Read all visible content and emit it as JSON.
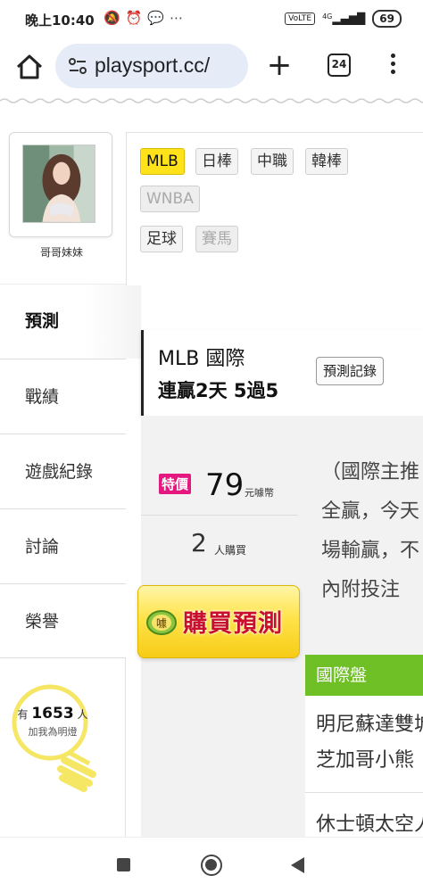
{
  "status_bar": {
    "time": "晚上10:40",
    "icons": [
      "mute-icon",
      "alarm-icon",
      "chat-bubble-icon",
      "more-dots-icon"
    ],
    "network": "VoLTE",
    "signal": "4G",
    "battery": "69"
  },
  "browser": {
    "url": "playsport.cc/",
    "new_tab": "+",
    "tab_count": "24"
  },
  "profile": {
    "name": "哥哥妹妹"
  },
  "sidebar": {
    "items": [
      {
        "label": "預測"
      },
      {
        "label": "戰績"
      },
      {
        "label": "遊戲紀錄"
      },
      {
        "label": "討論"
      },
      {
        "label": "榮譽"
      }
    ],
    "bulb": {
      "prefix": "有",
      "count": "1653",
      "suffix": "人",
      "caption": "加我為明燈"
    }
  },
  "league_tags": [
    {
      "label": "MLB",
      "state": "active"
    },
    {
      "label": "日棒",
      "state": "normal"
    },
    {
      "label": "中職",
      "state": "normal"
    },
    {
      "label": "韓棒",
      "state": "normal"
    },
    {
      "label": "WNBA",
      "state": "disabled"
    },
    {
      "label": "足球",
      "state": "normal"
    },
    {
      "label": "賽馬",
      "state": "disabled"
    }
  ],
  "header": {
    "title": "MLB 國際",
    "streak": "連贏2天 5過5",
    "record_button": "預測記錄"
  },
  "price": {
    "badge": "特價",
    "value": "79",
    "unit": "元噱幣",
    "buyers": "2",
    "buyers_label": "人購買",
    "buy_button": "購買預測",
    "buy_icon_char": "噱"
  },
  "description": [
    "（國際主推",
    "全贏，今天",
    "場輸贏，不",
    "內附投注"
  ],
  "market": {
    "title": "國際盤",
    "games": [
      "明尼蘇達雙城",
      "芝加哥小熊",
      "休士頓太空人"
    ]
  },
  "colors": {
    "active_tag": "#ffe21a",
    "special_badge": "#e4187e",
    "market_bar": "#6fbf27",
    "buy_text": "#c8102e"
  }
}
